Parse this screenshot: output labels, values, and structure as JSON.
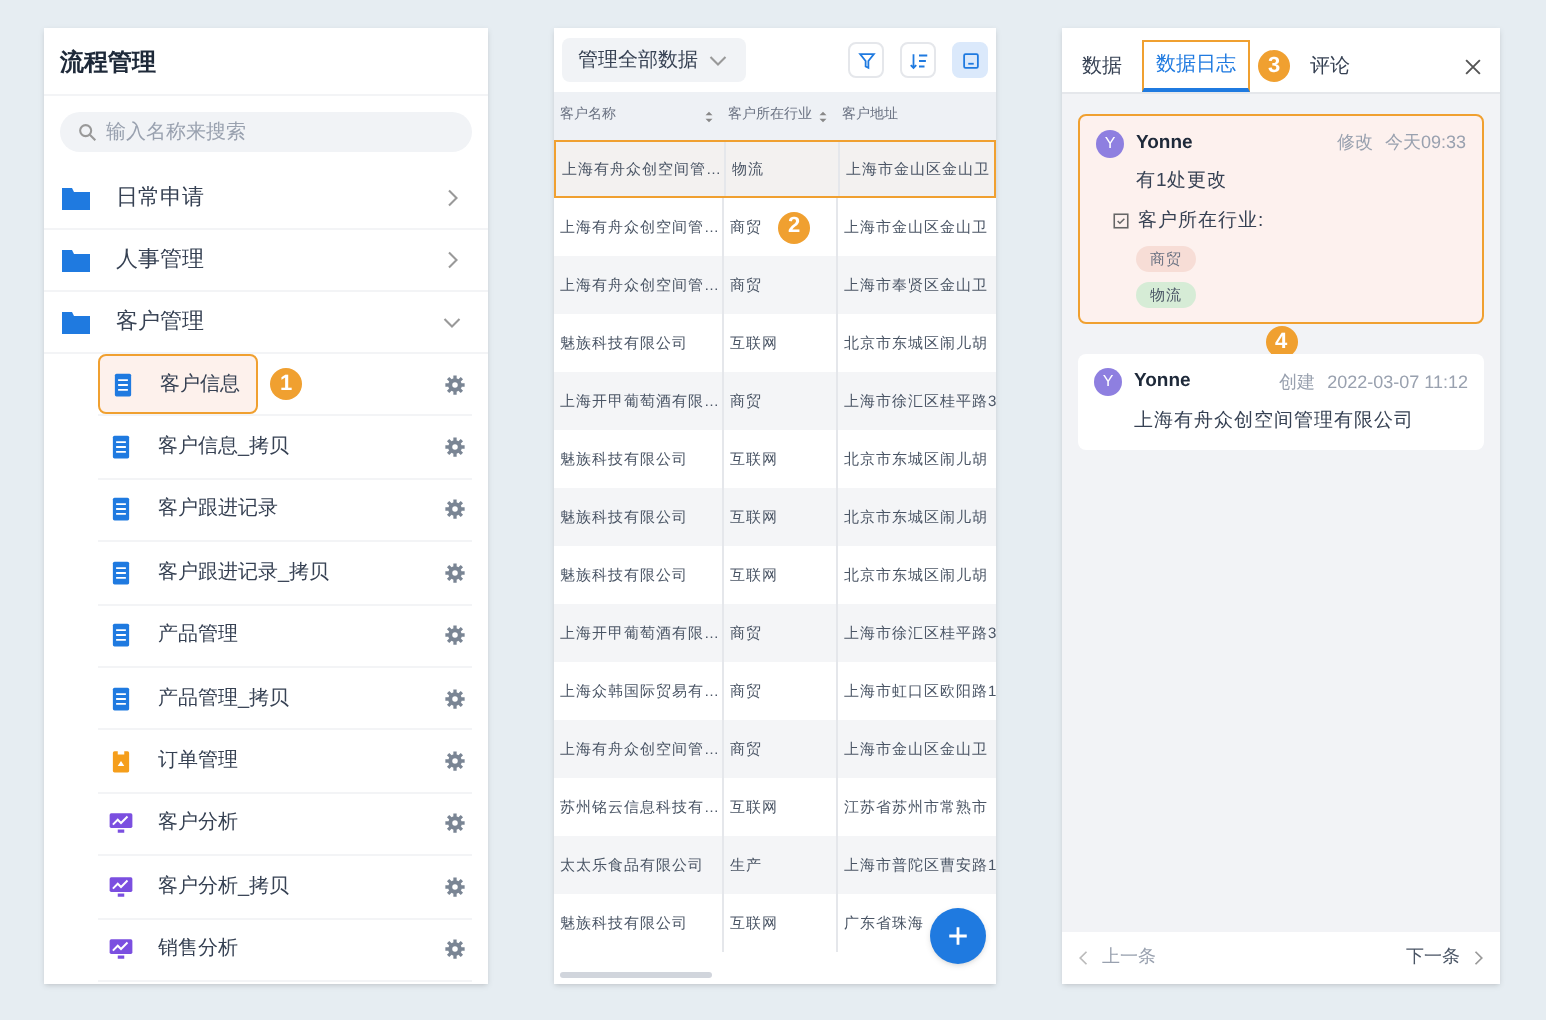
{
  "left_panel": {
    "title": "流程管理",
    "search": {
      "placeholder": "输入名称来搜索"
    },
    "folders": [
      {
        "label": "日常申请",
        "expanded": false
      },
      {
        "label": "人事管理",
        "expanded": false
      },
      {
        "label": "客户管理",
        "expanded": true,
        "children": [
          {
            "label": "客户信息",
            "kind": "form",
            "selected": true,
            "badge": "1"
          },
          {
            "label": "客户信息_拷贝",
            "kind": "form",
            "selected": false
          },
          {
            "label": "客户跟进记录",
            "kind": "form",
            "selected": false
          },
          {
            "label": "客户跟进记录_拷贝",
            "kind": "form",
            "selected": false
          },
          {
            "label": "产品管理",
            "kind": "form",
            "selected": false
          },
          {
            "label": "产品管理_拷贝",
            "kind": "form",
            "selected": false
          },
          {
            "label": "订单管理",
            "kind": "order",
            "selected": false
          },
          {
            "label": "客户分析",
            "kind": "report",
            "selected": false
          },
          {
            "label": "客户分析_拷贝",
            "kind": "report",
            "selected": false
          },
          {
            "label": "销售分析",
            "kind": "report",
            "selected": false
          }
        ]
      }
    ]
  },
  "table_panel": {
    "scope": "管理全部数据",
    "columns": [
      {
        "label": "客户名称",
        "sortable": true
      },
      {
        "label": "客户所在行业",
        "sortable": true
      },
      {
        "label": "客户地址",
        "sortable": false
      }
    ],
    "rows": [
      {
        "cells": [
          "上海有舟众创空间管…",
          "物流",
          "上海市金山区金山卫"
        ],
        "selected": true
      },
      {
        "cells": [
          "上海有舟众创空间管…",
          "商贸",
          "上海市金山区金山卫"
        ],
        "selected": false,
        "badge": "2"
      },
      {
        "cells": [
          "上海有舟众创空间管…",
          "商贸",
          "上海市奉贤区金山卫"
        ],
        "selected": false
      },
      {
        "cells": [
          "魅族科技有限公司",
          "互联网",
          "北京市东城区闹儿胡"
        ],
        "selected": false
      },
      {
        "cells": [
          "上海开甲葡萄酒有限…",
          "商贸",
          "上海市徐汇区桂平路3"
        ],
        "selected": false
      },
      {
        "cells": [
          "魅族科技有限公司",
          "互联网",
          "北京市东城区闹儿胡"
        ],
        "selected": false
      },
      {
        "cells": [
          "魅族科技有限公司",
          "互联网",
          "北京市东城区闹儿胡"
        ],
        "selected": false
      },
      {
        "cells": [
          "魅族科技有限公司",
          "互联网",
          "北京市东城区闹儿胡"
        ],
        "selected": false
      },
      {
        "cells": [
          "上海开甲葡萄酒有限…",
          "商贸",
          "上海市徐汇区桂平路3"
        ],
        "selected": false
      },
      {
        "cells": [
          "上海众韩国际贸易有…",
          "商贸",
          "上海市虹口区欧阳路1"
        ],
        "selected": false
      },
      {
        "cells": [
          "上海有舟众创空间管…",
          "商贸",
          "上海市金山区金山卫"
        ],
        "selected": false
      },
      {
        "cells": [
          "苏州铭云信息科技有…",
          "互联网",
          "江苏省苏州市常熟市"
        ],
        "selected": false
      },
      {
        "cells": [
          "太太乐食品有限公司",
          "生产",
          "上海市普陀区曹安路1"
        ],
        "selected": false
      },
      {
        "cells": [
          "魅族科技有限公司",
          "互联网",
          "广东省珠海"
        ],
        "selected": false
      }
    ]
  },
  "detail_panel": {
    "tabs": [
      {
        "label": "数据",
        "selected": false
      },
      {
        "label": "数据日志",
        "selected": true,
        "badge": "3"
      },
      {
        "label": "评论",
        "selected": false
      }
    ],
    "log": [
      {
        "avatar": "Y",
        "user": "Yonne",
        "action": "修改",
        "time": "今天09:33",
        "highlighted": true,
        "summary": "有1处更改",
        "field": "客户所在行业:",
        "old_value": "商贸",
        "new_value": "物流",
        "badge": "4"
      },
      {
        "avatar": "Y",
        "user": "Yonne",
        "action": "创建",
        "time": "2022-03-07 11:12",
        "highlighted": false,
        "text": "上海有舟众创空间管理有限公司"
      }
    ],
    "prev": {
      "label": "上一条",
      "disabled": true
    },
    "next": {
      "label": "下一条",
      "disabled": false
    }
  }
}
